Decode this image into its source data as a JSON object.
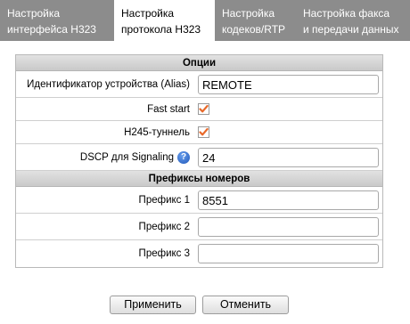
{
  "tabs": [
    {
      "line1": "Настройка",
      "line2": "интерфейса H323",
      "active": false
    },
    {
      "line1": "Настройка",
      "line2": "протокола H323",
      "active": true
    },
    {
      "line1": "Настройка",
      "line2": "кодеков/RTP",
      "active": false
    },
    {
      "line1": "Настройка факса",
      "line2": "и передачи данных",
      "active": false
    }
  ],
  "options": {
    "header": "Опции",
    "alias_label": "Идентификатор устройства (Alias)",
    "alias_value": "REMOTE",
    "fast_start_label": "Fast start",
    "fast_start_checked": true,
    "h245_label": "H245-туннель",
    "h245_checked": true,
    "dscp_label": "DSCP для Signaling",
    "dscp_value": "24"
  },
  "prefixes": {
    "header": "Префиксы номеров",
    "prefix1_label": "Префикс 1",
    "prefix1_value": "8551",
    "prefix2_label": "Префикс 2",
    "prefix2_value": "",
    "prefix3_label": "Префикс 3",
    "prefix3_value": ""
  },
  "buttons": {
    "apply": "Применить",
    "cancel": "Отменить"
  },
  "colors": {
    "tab_inactive": "#8c8c8c",
    "checkbox_accent": "#e8692a"
  }
}
